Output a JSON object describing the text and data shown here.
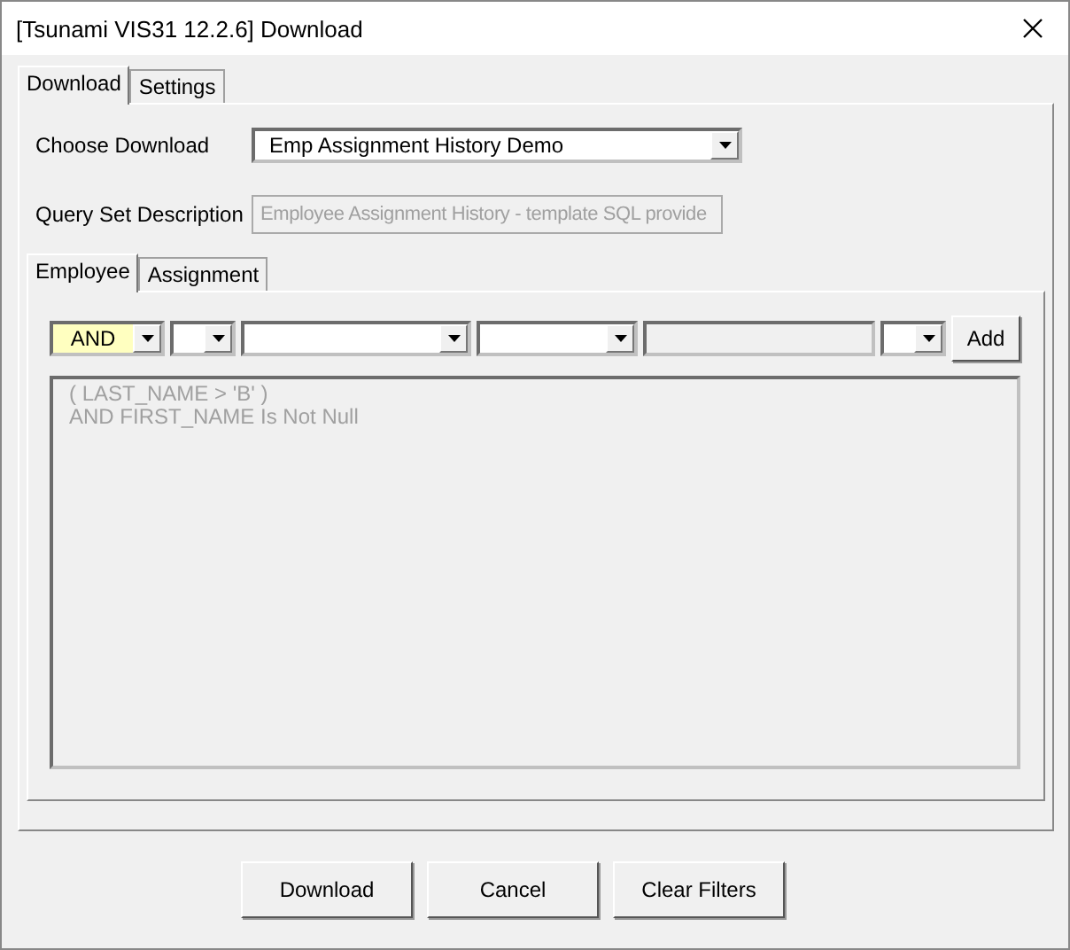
{
  "window": {
    "title": "[Tsunami VIS31 12.2.6] Download"
  },
  "tabs": [
    {
      "label": "Download",
      "selected": true
    },
    {
      "label": "Settings",
      "selected": false
    }
  ],
  "choose_download": {
    "label": "Choose Download",
    "value": "Emp Assignment History Demo"
  },
  "query_set_description": {
    "label": "Query Set Description",
    "value": "Employee Assignment History - template SQL provide",
    "disabled": true
  },
  "sub_tabs": [
    {
      "label": "Employee",
      "selected": true
    },
    {
      "label": "Assignment",
      "selected": false
    }
  ],
  "filter_row": [
    {
      "kind": "combo",
      "value": "AND",
      "highlighted": true
    },
    {
      "kind": "combo",
      "highlighted": false
    },
    {
      "kind": "combo",
      "highlighted": false
    },
    {
      "kind": "combo",
      "highlighted": false
    },
    {
      "kind": "field",
      "disabled": true
    },
    {
      "kind": "combo",
      "highlighted": false
    }
  ],
  "add_button": "Add",
  "filter_text": {
    "disabled": true,
    "lines": [
      "( LAST_NAME > 'B' )",
      "AND FIRST_NAME Is Not Null"
    ]
  },
  "buttons": [
    "Download",
    "Cancel",
    "Clear Filters"
  ]
}
